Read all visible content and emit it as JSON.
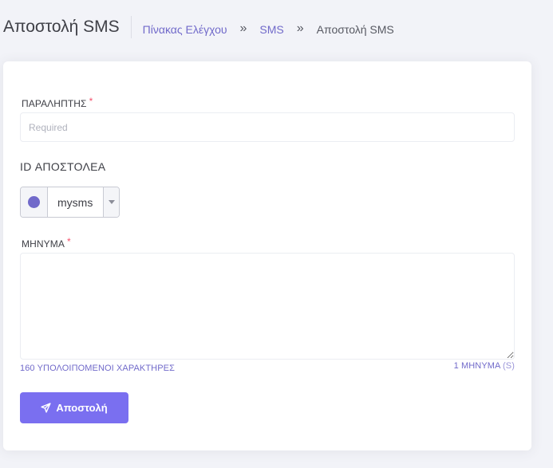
{
  "header": {
    "title": "Αποστολή SMS",
    "breadcrumb": [
      {
        "label": "Πίνακας Ελέγχου",
        "link": true
      },
      {
        "label": "SMS",
        "link": true
      },
      {
        "label": "Αποστολή SMS",
        "link": false
      }
    ],
    "separator": "»"
  },
  "form": {
    "recipient": {
      "label": "ΠΑΡΑΛΗΠΤΗΣ",
      "required_mark": "*",
      "placeholder": "Required",
      "value": ""
    },
    "sender": {
      "label": "ID ΑΠΟΣΤΟΛΕΑ",
      "selected": "mysms",
      "radio_checked": true
    },
    "message": {
      "label": "ΜΗΝΥΜΑ",
      "required_mark": "*",
      "value": "",
      "remaining_chars": "160 ΥΠΟΛΟΙΠΟΜΕΝΟΙ ΧΑΡΑΚΤΗΡΕΣ",
      "message_count": "1 ΜΗΝΥΜΑ",
      "message_count_suffix": "(S)"
    },
    "submit_label": "Αποστολή"
  },
  "colors": {
    "accent": "#716aca",
    "button": "#7a6ff0",
    "required": "#f4516c",
    "background": "#f2f3f8"
  }
}
